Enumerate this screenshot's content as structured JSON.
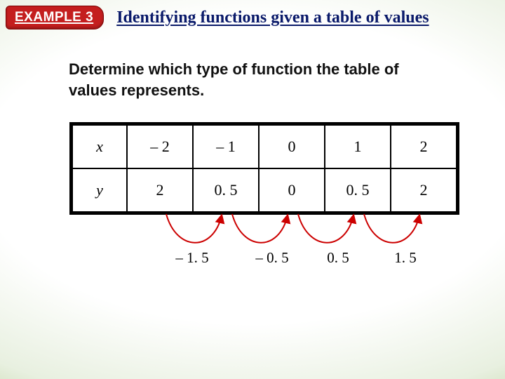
{
  "header": {
    "pill": "EXAMPLE 3",
    "title": "Identifying functions given a table of values"
  },
  "prompt": "Determine which type of function the table of values represents.",
  "table": {
    "row1": {
      "label": "x",
      "c0": "– 2",
      "c1": "– 1",
      "c2": "0",
      "c3": "1",
      "c4": "2"
    },
    "row2": {
      "label": "y",
      "c0": "2",
      "c1": "0. 5",
      "c2": "0",
      "c3": "0. 5",
      "c4": "2"
    }
  },
  "diffs": {
    "d0": "– 1. 5",
    "d1": "– 0. 5",
    "d2": "0. 5",
    "d3": "1. 5"
  },
  "chart_data": {
    "type": "table",
    "title": "Identifying functions given a table of values",
    "columns": [
      "x",
      "y"
    ],
    "rows": [
      {
        "x": -2,
        "y": 2
      },
      {
        "x": -1,
        "y": 0.5
      },
      {
        "x": 0,
        "y": 0
      },
      {
        "x": 1,
        "y": 0.5
      },
      {
        "x": 2,
        "y": 2
      }
    ],
    "first_differences_y": [
      -1.5,
      -0.5,
      0.5,
      1.5
    ]
  }
}
